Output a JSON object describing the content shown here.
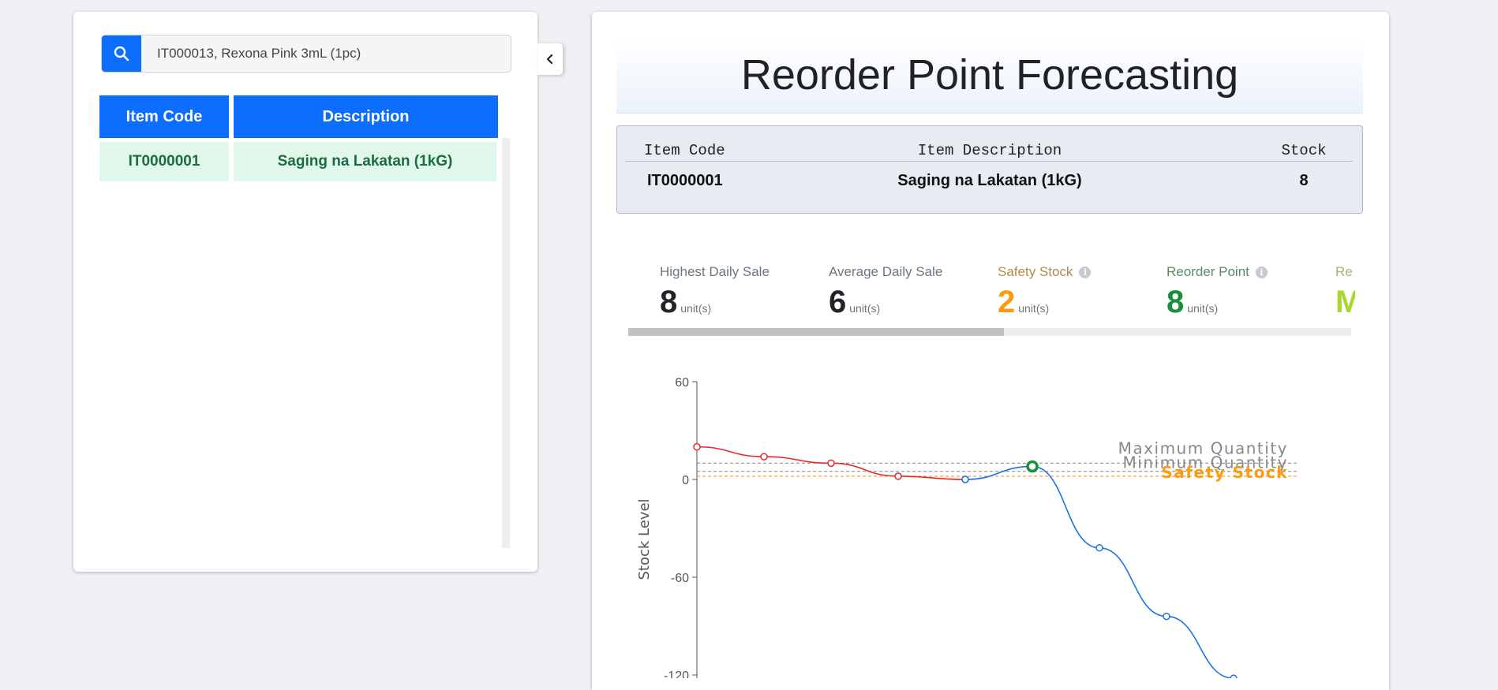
{
  "search": {
    "value": "IT000013, Rexona Pink 3mL (1pc)"
  },
  "item_table": {
    "headers": [
      "Item Code",
      "Description"
    ],
    "rows": [
      {
        "code": "IT0000001",
        "description": "Saging na Lakatan (1kG)"
      }
    ]
  },
  "page_title": "Reorder Point Forecasting",
  "selected_item": {
    "headers": {
      "code": "Item Code",
      "description": "Item Description",
      "stock": "Stock"
    },
    "code": "IT0000001",
    "description": "Saging na Lakatan (1kG)",
    "stock": "8"
  },
  "stats": [
    {
      "label": "Highest Daily Sale",
      "value": "8",
      "unit": "unit(s)",
      "label_color": "#6c757d",
      "value_color": "#212529",
      "info": false
    },
    {
      "label": "Average Daily Sale",
      "value": "6",
      "unit": "unit(s)",
      "label_color": "#6c757d",
      "value_color": "#212529",
      "info": false
    },
    {
      "label": "Safety Stock",
      "value": "2",
      "unit": "unit(s)",
      "label_color": "#b5894a",
      "value_color": "#fd9a0e",
      "info": true
    },
    {
      "label": "Reorder Point",
      "value": "8",
      "unit": "unit(s)",
      "label_color": "#5b8a64",
      "value_color": "#198f3c",
      "info": true
    },
    {
      "label": "Re",
      "value": "M",
      "unit": "",
      "label_color": "#a9b46a",
      "value_color": "#a6d92b",
      "info": false
    }
  ],
  "stats_scroll": {
    "position": 0.52
  },
  "chart_data": {
    "type": "line",
    "ylabel": "Stock Level",
    "yticks": [
      60,
      0,
      -60,
      -120
    ],
    "ylim": [
      -120,
      60
    ],
    "reference_lines": [
      {
        "label": "Maximum Quantity",
        "y": 10,
        "color": "#888888"
      },
      {
        "label": "Minimum Quantity",
        "y": 5,
        "color": "#888888"
      },
      {
        "label": "Safety Stock",
        "y": 2,
        "color": "#fd9a0e"
      }
    ],
    "series": [
      {
        "name": "",
        "color": "#e8272b",
        "x": [
          0,
          1,
          2,
          3,
          4
        ],
        "values": [
          20,
          14,
          10,
          2,
          0
        ]
      },
      {
        "name": "",
        "color": "#1b73e8",
        "x": [
          4,
          5,
          6,
          7,
          8
        ],
        "values": [
          0,
          8,
          -42,
          -84,
          -122
        ]
      }
    ],
    "highlight_point": {
      "x": 5,
      "y": 8,
      "color": "#198f3c"
    }
  },
  "colors": {
    "accent": "#0d6efd",
    "row_bg": "#dff8ea",
    "row_text": "#1d6a43"
  },
  "icons": {
    "search": "search-icon",
    "collapse": "chevron-left-icon",
    "info": "info-icon"
  }
}
